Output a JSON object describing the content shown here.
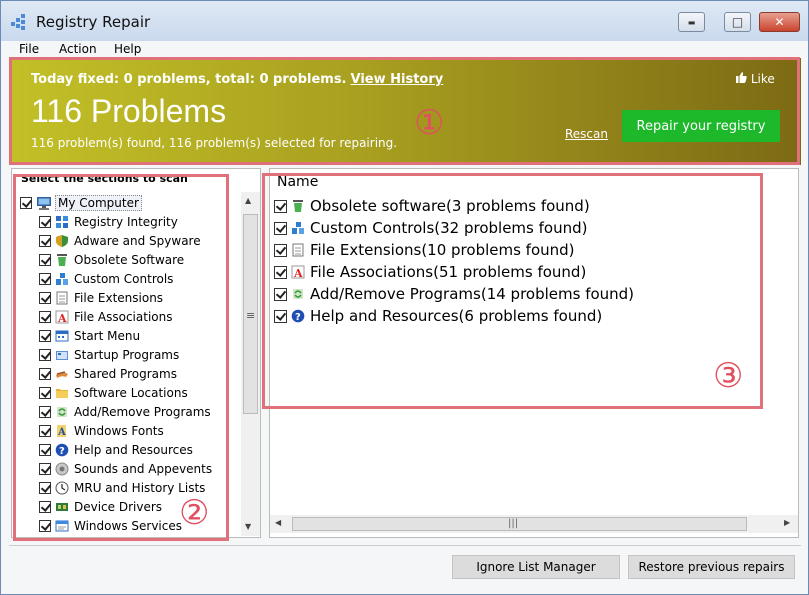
{
  "window": {
    "title": "Registry Repair"
  },
  "controls": {
    "minimize": "▬",
    "maximize": "□",
    "close": "✕"
  },
  "menu": [
    "File",
    "Action",
    "Help"
  ],
  "banner": {
    "today_text": "Today fixed: 0 problems, total: 0 problems.",
    "view_history": "View History",
    "like": "Like",
    "headline": "116 Problems",
    "found_text": "116 problem(s) found, 116 problem(s) selected for repairing.",
    "rescan": "Rescan",
    "repair_button": "Repair your registry",
    "gradient_colors": [
      "#c2c027",
      "#7d6a14"
    ],
    "repair_color": "#1db92b"
  },
  "markers": {
    "one": "①",
    "two": "②",
    "three": "③"
  },
  "left": {
    "heading": "Select the sections to scan",
    "root": "My Computer",
    "items": [
      {
        "label": "Registry Integrity",
        "icon": "registry-icon"
      },
      {
        "label": "Adware and Spyware",
        "icon": "shield-icon"
      },
      {
        "label": "Obsolete Software",
        "icon": "recycle-bin-icon"
      },
      {
        "label": "Custom Controls",
        "icon": "controls-icon"
      },
      {
        "label": "File Extensions",
        "icon": "file-icon"
      },
      {
        "label": "File Associations",
        "icon": "file-association-icon"
      },
      {
        "label": "Start Menu",
        "icon": "start-menu-icon"
      },
      {
        "label": "Startup Programs",
        "icon": "startup-icon"
      },
      {
        "label": "Shared Programs",
        "icon": "shared-icon"
      },
      {
        "label": "Software Locations",
        "icon": "folder-icon"
      },
      {
        "label": "Add/Remove Programs",
        "icon": "add-remove-icon"
      },
      {
        "label": "Windows Fonts",
        "icon": "font-icon"
      },
      {
        "label": "Help and Resources",
        "icon": "help-icon"
      },
      {
        "label": "Sounds and Appevents",
        "icon": "sound-icon"
      },
      {
        "label": "MRU and History Lists",
        "icon": "history-icon"
      },
      {
        "label": "Device Drivers",
        "icon": "driver-icon"
      },
      {
        "label": "Windows Services",
        "icon": "services-icon"
      }
    ]
  },
  "right": {
    "column": "Name",
    "results": [
      {
        "label": "Obsolete software(3 problems found)",
        "icon": "recycle-bin-icon"
      },
      {
        "label": "Custom Controls(32 problems found)",
        "icon": "controls-icon"
      },
      {
        "label": "File Extensions(10 problems found)",
        "icon": "file-icon"
      },
      {
        "label": "File Associations(51 problems found)",
        "icon": "file-association-icon"
      },
      {
        "label": "Add/Remove Programs(14 problems found)",
        "icon": "add-remove-icon"
      },
      {
        "label": "Help and Resources(6 problems found)",
        "icon": "help-icon"
      }
    ]
  },
  "footer": {
    "ignore_button": "Ignore List Manager",
    "restore_button": "Restore previous repairs"
  }
}
